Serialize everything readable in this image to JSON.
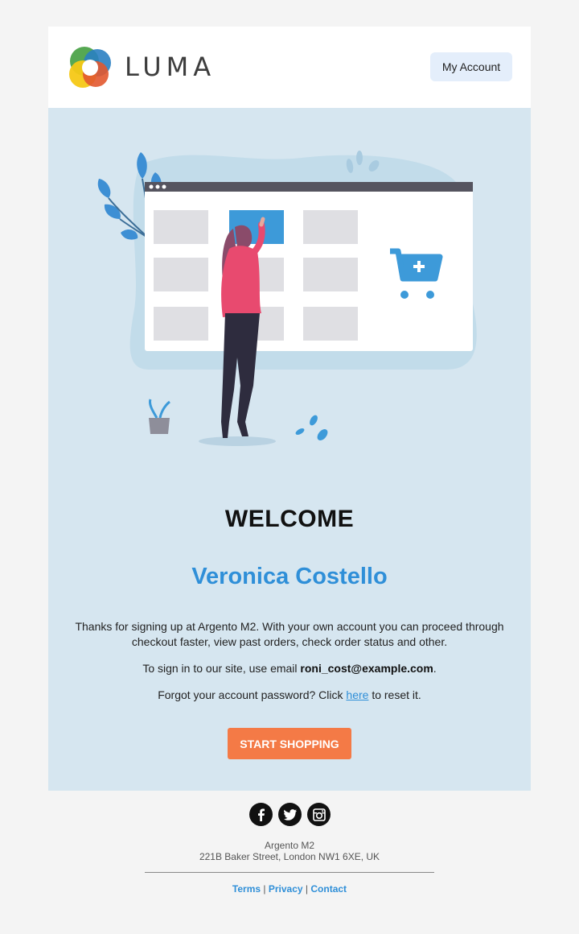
{
  "header": {
    "logo_text": "LUMA",
    "account_button": "My Account"
  },
  "hero": {
    "welcome": "WELCOME",
    "customer_name": "Veronica Costello",
    "intro_text": "Thanks for signing up at Argento M2. With your own account you can proceed through checkout faster, view past orders, check order status and other.",
    "signin_prefix": "To sign in to our site, use email ",
    "email": "roni_cost@example.com",
    "signin_suffix": ".",
    "forgot_prefix": "Forgot your account password? Click ",
    "forgot_link": "here",
    "forgot_suffix": " to reset it.",
    "cta_button": "START SHOPPING"
  },
  "footer": {
    "social_icons": [
      "facebook-icon",
      "twitter-icon",
      "instagram-icon"
    ],
    "company_name": "Argento M2",
    "address": "221B Baker Street, London NW1 6XE, UK",
    "links": [
      "Terms",
      "Privacy",
      "Contact"
    ],
    "separator": "|"
  },
  "colors": {
    "hero_background": "#d6e6f0",
    "accent_blue": "#2f8fd8",
    "cta_orange": "#f47a46",
    "account_button_bg": "#e4eefb"
  }
}
